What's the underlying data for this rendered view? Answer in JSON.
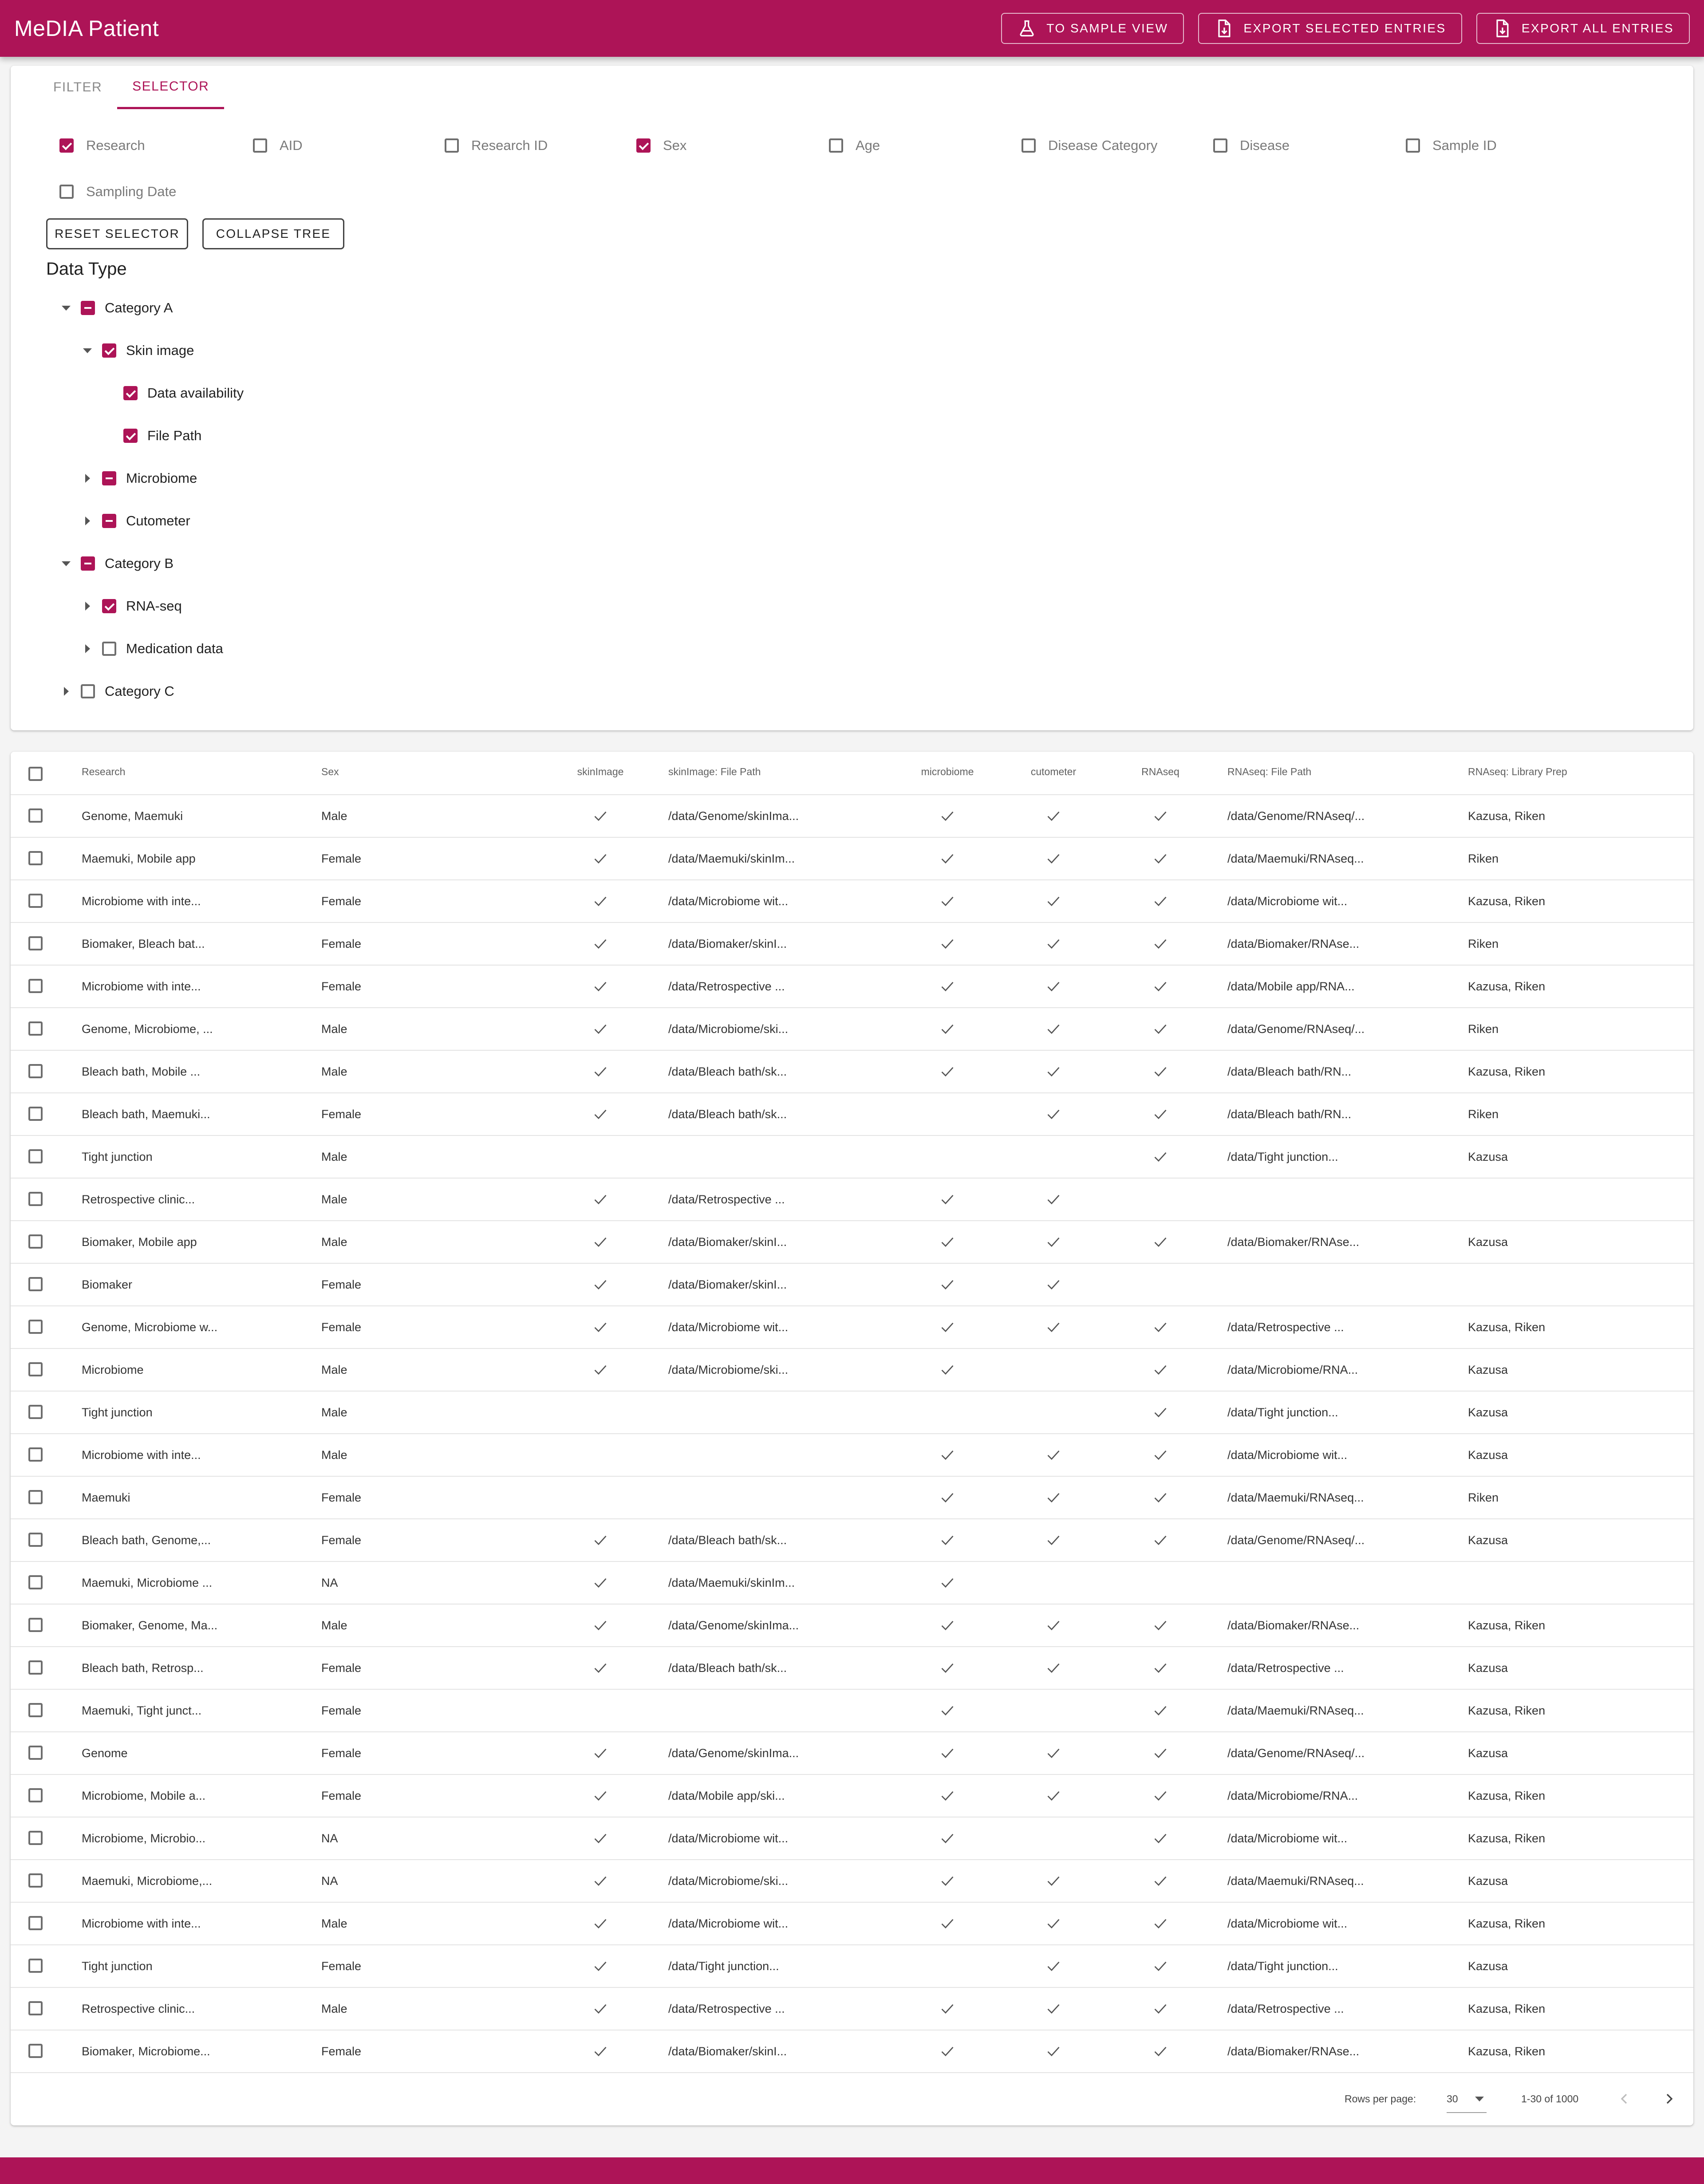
{
  "app": {
    "title": "MeDIA Patient",
    "actions": [
      {
        "label": "TO SAMPLE VIEW",
        "icon": "flask-icon"
      },
      {
        "label": "EXPORT SELECTED ENTRIES",
        "icon": "file-export-icon"
      },
      {
        "label": "EXPORT ALL ENTRIES",
        "icon": "file-export-icon"
      }
    ]
  },
  "tabs": [
    {
      "label": "FILTER",
      "active": false
    },
    {
      "label": "SELECTOR",
      "active": true
    }
  ],
  "fields": [
    {
      "label": "Research",
      "checked": true
    },
    {
      "label": "AID",
      "checked": false
    },
    {
      "label": "Research ID",
      "checked": false
    },
    {
      "label": "Sex",
      "checked": true
    },
    {
      "label": "Age",
      "checked": false
    },
    {
      "label": "Disease Category",
      "checked": false
    },
    {
      "label": "Disease",
      "checked": false
    },
    {
      "label": "Sample ID",
      "checked": false
    },
    {
      "label": "Sampling Date",
      "checked": false
    }
  ],
  "buttons": {
    "reset": "RESET SELECTOR",
    "collapse": "COLLAPSE TREE"
  },
  "data_type": {
    "title": "Data Type",
    "nodes": [
      {
        "label": "Category A",
        "state": "indeterminate",
        "expanded": true,
        "level": 0
      },
      {
        "label": "Skin image",
        "state": "checked",
        "expanded": true,
        "level": 1
      },
      {
        "label": "Data availability",
        "state": "checked",
        "level": 2
      },
      {
        "label": "File Path",
        "state": "checked",
        "level": 2
      },
      {
        "label": "Microbiome",
        "state": "indeterminate",
        "expanded": false,
        "level": 1
      },
      {
        "label": "Cutometer",
        "state": "indeterminate",
        "expanded": false,
        "level": 1
      },
      {
        "label": "Category B",
        "state": "indeterminate",
        "expanded": true,
        "level": 0
      },
      {
        "label": "RNA-seq",
        "state": "checked",
        "expanded": false,
        "level": 1
      },
      {
        "label": "Medication data",
        "state": "unchecked",
        "expanded": false,
        "level": 1
      },
      {
        "label": "Category C",
        "state": "unchecked",
        "expanded": false,
        "level": 0
      }
    ]
  },
  "table": {
    "columns": [
      "Research",
      "Sex",
      "skinImage",
      "skinImage: File Path",
      "microbiome",
      "cutometer",
      "RNAseq",
      "RNAseq: File Path",
      "RNAseq: Library Prep"
    ],
    "rows": [
      [
        "Genome, Maemuki",
        "Male",
        true,
        "/data/Genome/skinIma...",
        true,
        true,
        true,
        "/data/Genome/RNAseq/...",
        "Kazusa, Riken"
      ],
      [
        "Maemuki, Mobile app",
        "Female",
        true,
        "/data/Maemuki/skinIm...",
        true,
        true,
        true,
        "/data/Maemuki/RNAseq...",
        "Riken"
      ],
      [
        "Microbiome with inte...",
        "Female",
        true,
        "/data/Microbiome wit...",
        true,
        true,
        true,
        "/data/Microbiome wit...",
        "Kazusa, Riken"
      ],
      [
        "Biomaker, Bleach bat...",
        "Female",
        true,
        "/data/Biomaker/skinI...",
        true,
        true,
        true,
        "/data/Biomaker/RNAse...",
        "Riken"
      ],
      [
        "Microbiome with inte...",
        "Female",
        true,
        "/data/Retrospective ...",
        true,
        true,
        true,
        "/data/Mobile app/RNA...",
        "Kazusa, Riken"
      ],
      [
        "Genome, Microbiome, ...",
        "Male",
        true,
        "/data/Microbiome/ski...",
        true,
        true,
        true,
        "/data/Genome/RNAseq/...",
        "Riken"
      ],
      [
        "Bleach bath, Mobile ...",
        "Male",
        true,
        "/data/Bleach bath/sk...",
        true,
        true,
        true,
        "/data/Bleach bath/RN...",
        "Kazusa, Riken"
      ],
      [
        "Bleach bath, Maemuki...",
        "Female",
        true,
        "/data/Bleach bath/sk...",
        false,
        true,
        true,
        "/data/Bleach bath/RN...",
        "Riken"
      ],
      [
        "Tight junction",
        "Male",
        false,
        "",
        false,
        false,
        true,
        "/data/Tight junction...",
        "Kazusa"
      ],
      [
        "Retrospective clinic...",
        "Male",
        true,
        "/data/Retrospective ...",
        true,
        true,
        false,
        "",
        ""
      ],
      [
        "Biomaker, Mobile app",
        "Male",
        true,
        "/data/Biomaker/skinI...",
        true,
        true,
        true,
        "/data/Biomaker/RNAse...",
        "Kazusa"
      ],
      [
        "Biomaker",
        "Female",
        true,
        "/data/Biomaker/skinI...",
        true,
        true,
        false,
        "",
        ""
      ],
      [
        "Genome, Microbiome w...",
        "Female",
        true,
        "/data/Microbiome wit...",
        true,
        true,
        true,
        "/data/Retrospective ...",
        "Kazusa, Riken"
      ],
      [
        "Microbiome",
        "Male",
        true,
        "/data/Microbiome/ski...",
        true,
        false,
        true,
        "/data/Microbiome/RNA...",
        "Kazusa"
      ],
      [
        "Tight junction",
        "Male",
        false,
        "",
        false,
        false,
        true,
        "/data/Tight junction...",
        "Kazusa"
      ],
      [
        "Microbiome with inte...",
        "Male",
        false,
        "",
        true,
        true,
        true,
        "/data/Microbiome wit...",
        "Kazusa"
      ],
      [
        "Maemuki",
        "Female",
        false,
        "",
        true,
        true,
        true,
        "/data/Maemuki/RNAseq...",
        "Riken"
      ],
      [
        "Bleach bath, Genome,...",
        "Female",
        true,
        "/data/Bleach bath/sk...",
        true,
        true,
        true,
        "/data/Genome/RNAseq/...",
        "Kazusa"
      ],
      [
        "Maemuki, Microbiome ...",
        "NA",
        true,
        "/data/Maemuki/skinIm...",
        true,
        false,
        false,
        "",
        ""
      ],
      [
        "Biomaker, Genome, Ma...",
        "Male",
        true,
        "/data/Genome/skinIma...",
        true,
        true,
        true,
        "/data/Biomaker/RNAse...",
        "Kazusa, Riken"
      ],
      [
        "Bleach bath, Retrosp...",
        "Female",
        true,
        "/data/Bleach bath/sk...",
        true,
        true,
        true,
        "/data/Retrospective ...",
        "Kazusa"
      ],
      [
        "Maemuki, Tight junct...",
        "Female",
        false,
        "",
        true,
        false,
        true,
        "/data/Maemuki/RNAseq...",
        "Kazusa, Riken"
      ],
      [
        "Genome",
        "Female",
        true,
        "/data/Genome/skinIma...",
        true,
        true,
        true,
        "/data/Genome/RNAseq/...",
        "Kazusa"
      ],
      [
        "Microbiome, Mobile a...",
        "Female",
        true,
        "/data/Mobile app/ski...",
        true,
        true,
        true,
        "/data/Microbiome/RNA...",
        "Kazusa, Riken"
      ],
      [
        "Microbiome, Microbio...",
        "NA",
        true,
        "/data/Microbiome wit...",
        true,
        false,
        true,
        "/data/Microbiome wit...",
        "Kazusa, Riken"
      ],
      [
        "Maemuki, Microbiome,...",
        "NA",
        true,
        "/data/Microbiome/ski...",
        true,
        true,
        true,
        "/data/Maemuki/RNAseq...",
        "Kazusa"
      ],
      [
        "Microbiome with inte...",
        "Male",
        true,
        "/data/Microbiome wit...",
        true,
        true,
        true,
        "/data/Microbiome wit...",
        "Kazusa, Riken"
      ],
      [
        "Tight junction",
        "Female",
        true,
        "/data/Tight junction...",
        false,
        true,
        true,
        "/data/Tight junction...",
        "Kazusa"
      ],
      [
        "Retrospective clinic...",
        "Male",
        true,
        "/data/Retrospective ...",
        true,
        true,
        true,
        "/data/Retrospective ...",
        "Kazusa, Riken"
      ],
      [
        "Biomaker, Microbiome...",
        "Female",
        true,
        "/data/Biomaker/skinI...",
        true,
        true,
        true,
        "/data/Biomaker/RNAse...",
        "Kazusa, Riken"
      ]
    ]
  },
  "pagination": {
    "rows_per_page_label": "Rows per page:",
    "rows_per_page": "30",
    "range": "1-30 of 1000"
  },
  "colors": {
    "primary": "#ad1457"
  }
}
